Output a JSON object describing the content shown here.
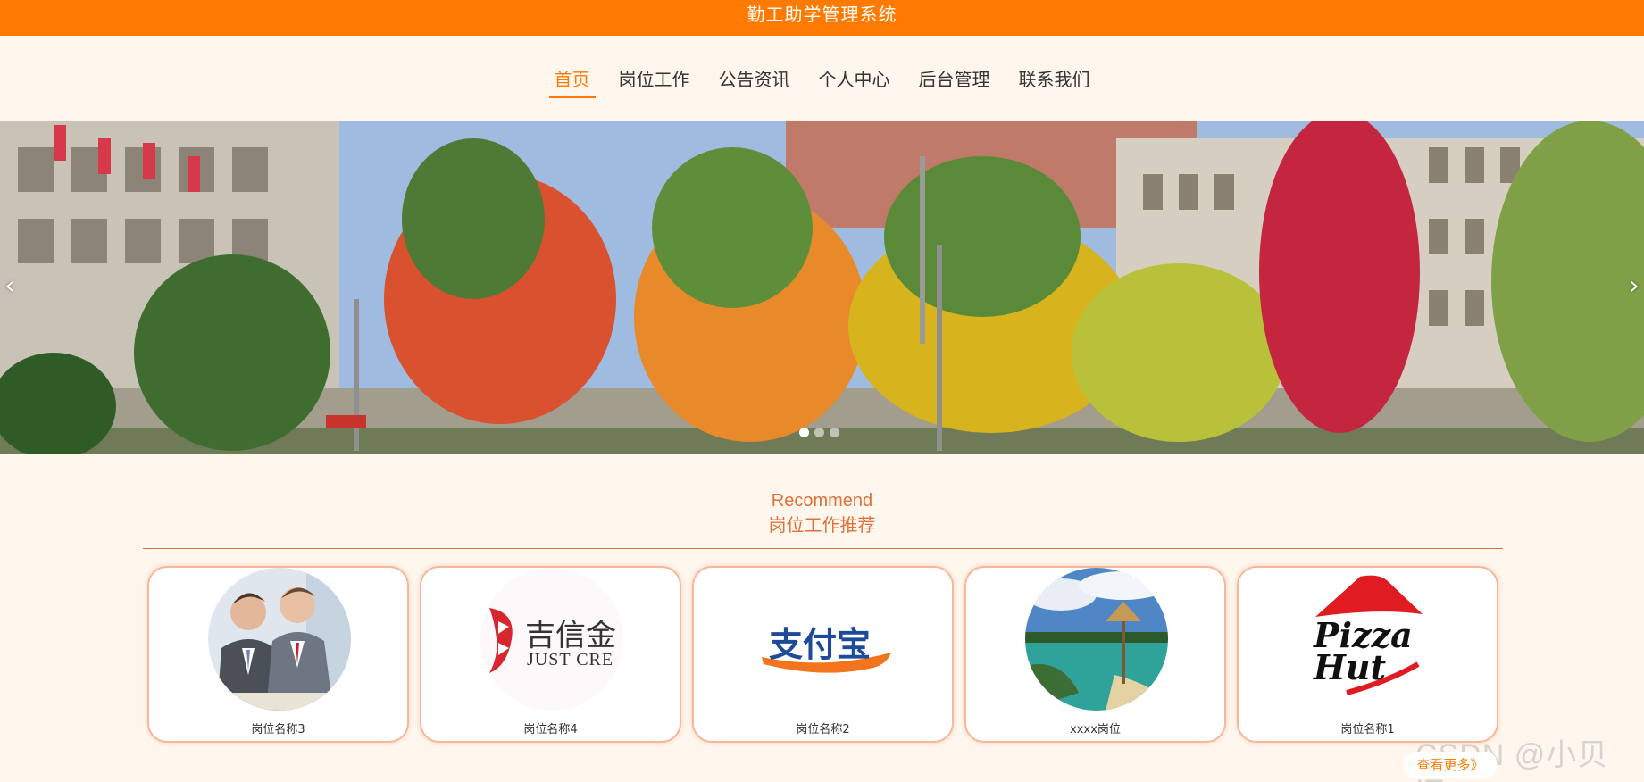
{
  "header": {
    "title": "勤工助学管理系统"
  },
  "nav": {
    "items": [
      {
        "label": "首页",
        "active": true
      },
      {
        "label": "岗位工作",
        "active": false
      },
      {
        "label": "公告资讯",
        "active": false
      },
      {
        "label": "个人中心",
        "active": false
      },
      {
        "label": "后台管理",
        "active": false
      },
      {
        "label": "联系我们",
        "active": false
      }
    ]
  },
  "banner": {
    "prev_icon": "chevron-left-icon",
    "next_icon": "chevron-right-icon",
    "prev_glyph": "‹",
    "next_glyph": "›",
    "slide_count": 3,
    "active_slide": 1
  },
  "recommend": {
    "heading_en": "Recommend",
    "heading_cn": "岗位工作推荐",
    "cards": [
      {
        "name": "岗位名称3",
        "image": "business-meeting-photo"
      },
      {
        "name": "岗位名称4",
        "image": "just-credit-logo",
        "logo_text_cn": "吉信金",
        "logo_text_en": "JUST CRE"
      },
      {
        "name": "岗位名称2",
        "image": "alipay-logo",
        "logo_text": "支付宝"
      },
      {
        "name": "xxxx岗位",
        "image": "beach-hut-photo"
      },
      {
        "name": "岗位名称1",
        "image": "pizza-hut-logo",
        "logo_text": "Pizza Hut"
      }
    ],
    "more_label": "查看更多》"
  },
  "watermark": "CSDN @小贝IT~",
  "colors": {
    "accent": "#ff7a00",
    "heading": "#e0703a",
    "background": "#fff7ee"
  }
}
